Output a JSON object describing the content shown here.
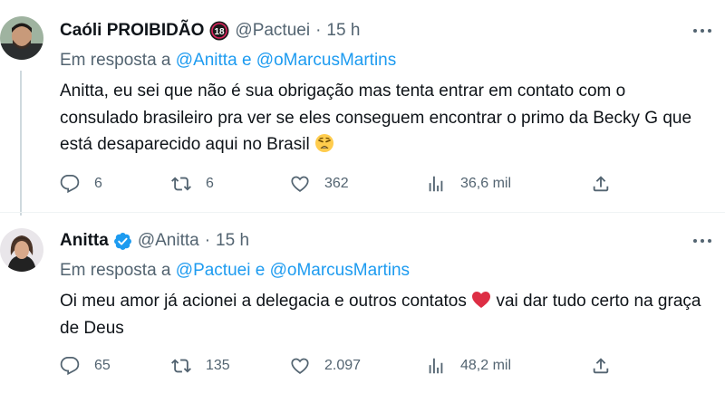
{
  "tweets": [
    {
      "name": "Caóli PROIBIDÃO",
      "handle": "@Pactuei",
      "dot": "·",
      "time": "15 h",
      "reply_prefix": "Em resposta a",
      "reply_mentions": [
        "@Anitta",
        "e",
        "@oMarcusMartins"
      ],
      "text": "Anitta, eu sei que não é sua obrigação mas tenta entrar em contato com o consulado brasileiro pra ver se eles conseguem encontrar o primo da Becky G que está desaparecido aqui no Brasil",
      "emoji": "weary-face-icon",
      "badge": "18",
      "counts": {
        "replies": "6",
        "retweets": "6",
        "likes": "362",
        "views": "36,6 mil"
      }
    },
    {
      "name": "Anitta",
      "handle": "@Anitta",
      "dot": "·",
      "time": "15 h",
      "reply_prefix": "Em resposta a",
      "reply_mentions": [
        "@Pactuei",
        "e",
        "@oMarcusMartins"
      ],
      "text_before_emoji": "Oi meu amor já acionei a delegacia e outros contatos",
      "text_after_emoji": "vai dar tudo certo na graça de Deus",
      "emoji": "red-heart-icon",
      "verified": true,
      "counts": {
        "replies": "65",
        "retweets": "135",
        "likes": "2.097",
        "views": "48,2 mil"
      }
    }
  ],
  "colors": {
    "text": "#0f1419",
    "muted": "#536471",
    "link": "#1d9bf0",
    "heart": "#e0245e",
    "verified": "#1d9bf0"
  }
}
